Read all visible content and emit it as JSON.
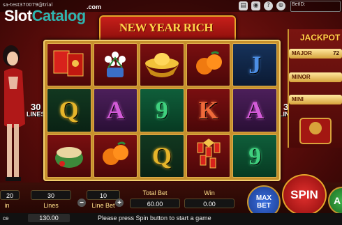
{
  "topbar": {
    "session": "sa-test370079@trial",
    "betid_label": "BetID:",
    "icons": [
      "chat-icon",
      "sound-icon",
      "help-icon",
      "globe-icon"
    ]
  },
  "watermark": {
    "slot": "Slot",
    "catalog": "Catalog",
    "com": ".com"
  },
  "game_title": "NEW YEAR RICH",
  "side_lines": {
    "count": "30",
    "label": "LINES"
  },
  "reels": [
    [
      {
        "sym": "red-envelopes-icon",
        "style": "red"
      },
      {
        "sym": "Q",
        "style": "dark",
        "color": "#e6b52a"
      },
      {
        "sym": "melon-icon",
        "style": "red"
      }
    ],
    [
      {
        "sym": "flowers-icon",
        "style": "red"
      },
      {
        "sym": "A",
        "style": "purple",
        "color": "#d35bd8"
      },
      {
        "sym": "oranges-icon",
        "style": "red"
      }
    ],
    [
      {
        "sym": "gold-ingot-icon",
        "style": "red"
      },
      {
        "sym": "9",
        "style": "green",
        "color": "#3fd07e"
      },
      {
        "sym": "Q",
        "style": "dark",
        "color": "#e6b52a"
      }
    ],
    [
      {
        "sym": "oranges-icon",
        "style": "red"
      },
      {
        "sym": "K",
        "style": "red",
        "color": "#f06a3a"
      },
      {
        "sym": "firecrackers-icon",
        "style": "red"
      }
    ],
    [
      {
        "sym": "J",
        "style": "blue",
        "color": "#4d8fe6"
      },
      {
        "sym": "A",
        "style": "purple",
        "color": "#d35bd8"
      },
      {
        "sym": "9",
        "style": "green",
        "color": "#3fd07e"
      }
    ]
  ],
  "jackpot": {
    "title": "JACKPOT",
    "major_label": "MAJOR",
    "major_value": "72",
    "minor_label": "MINOR",
    "mini_label": "MINI"
  },
  "controls": {
    "coin_value": "20",
    "lines_value": "30",
    "lines_label": "Lines",
    "line_bet_value": "10",
    "line_bet_label": "Line Bet",
    "minus": "−",
    "plus": "+",
    "total_bet_label": "Total Bet",
    "total_bet_value": "60.00",
    "win_label": "Win",
    "win_value": "0.00",
    "max_bet": "MAX BET",
    "spin": "SPIN",
    "auto_partial": "A",
    "coin_label": "in",
    "balance_label": "ce",
    "balance_value": "130.00",
    "status_message": "Please press Spin button to start a game"
  },
  "colors": {
    "accent_gold": "#e5a62a",
    "spin_red": "#c4161c",
    "max_bet_blue": "#1f4fb3"
  }
}
